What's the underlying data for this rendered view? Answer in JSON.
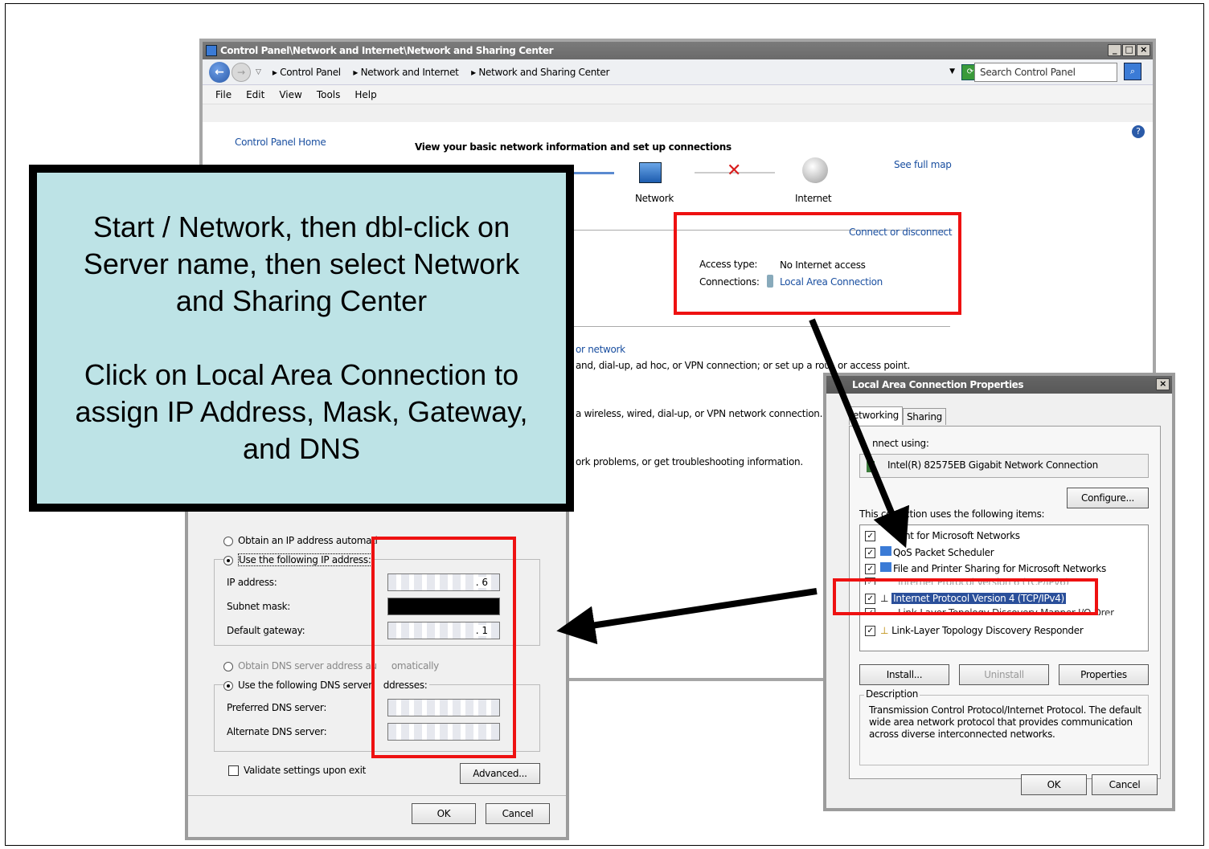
{
  "cp_window": {
    "title": "Control Panel\\Network and Internet\\Network and Sharing Center",
    "crumbs": [
      "Control Panel",
      "Network and Internet",
      "Network and Sharing Center"
    ],
    "search_placeholder": "Search Control Panel",
    "menu": [
      "File",
      "Edit",
      "View",
      "Tools",
      "Help"
    ],
    "home_link": "Control Panel Home",
    "heading": "View your basic network information and set up connections",
    "see_full_map": "See full map",
    "map_nodes": [
      "Network",
      "Internet"
    ],
    "connect_link": "Connect or disconnect",
    "access_type_label": "Access type:",
    "access_type_value": "No Internet access",
    "connections_label": "Connections:",
    "connections_value": "Local Area Connection",
    "change_link_fragment": "or network",
    "line1": "and, dial-up, ad hoc, or VPN connection; or set up a rou",
    "line1b": "or access point.",
    "line2": "a wireless, wired, dial-up, or VPN network connection.",
    "line3": "ork problems, or get troubleshooting information."
  },
  "callout": {
    "lines": [
      "Start / Network, then dbl-click on",
      "Server name, then select Network",
      "and Sharing Center",
      "",
      "Click on Local Area Connection to",
      "assign IP Address, Mask, Gateway,",
      "and DNS"
    ]
  },
  "tcpip": {
    "obtain_ip": "Obtain an IP address automati",
    "use_ip": "Use the following IP address:",
    "ip_label": "IP address:",
    "ip_value": ". 6",
    "mask_label": "Subnet mask:",
    "gateway_label": "Default gateway:",
    "gateway_value": ". 1",
    "obtain_dns": "Obtain DNS server address au",
    "obtain_dns_b": "omatically",
    "use_dns": "Use the following DNS server",
    "use_dns_b": "ddresses:",
    "pref_dns": "Preferred DNS server:",
    "alt_dns": "Alternate DNS server:",
    "validate": "Validate settings upon exit",
    "advanced": "Advanced...",
    "ok": "OK",
    "cancel": "Cancel"
  },
  "lac": {
    "title": "Local Area Connection Properties",
    "tabs": [
      "etworking",
      "Sharing"
    ],
    "connect_using": "nnect using:",
    "adapter": "Intel(R) 82575EB Gigabit Network Connection",
    "configure": "Configure...",
    "items_label": "This co",
    "items_label_b": "ction uses the following items:",
    "items": [
      "nt for Microsoft Networks",
      "QoS Packet Scheduler",
      "File and Printer Sharing for Microsoft Networks",
      "Internet Protocol Version 6 (TCP/IPv6)",
      "Internet Protocol Version 4 (TCP/IPv4)",
      "Link-Layer Topology Discovery Mapper I/O Dr",
      "er",
      "Link-Layer Topology Discovery Responder"
    ],
    "install": "Install...",
    "uninstall": "Uninstall",
    "properties": "Properties",
    "description_label": "Description",
    "description": "Transmission Control Protocol/Internet Protocol. The default wide area network protocol that provides communication across diverse interconnected networks.",
    "ok": "OK",
    "cancel": "Cancel"
  }
}
